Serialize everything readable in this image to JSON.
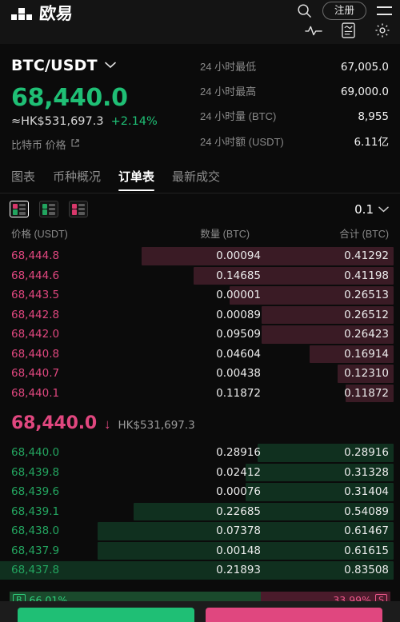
{
  "topbar": {
    "brand_name": "欧易",
    "logo_icon": "okx-logo-icon",
    "search_icon": "search-icon",
    "register_label": "注册",
    "menu_icon": "hamburger-menu-icon",
    "chart_icon": "pulse-chart-icon",
    "report_icon": "document-report-icon",
    "settings_icon": "gear-icon"
  },
  "ticker": {
    "pair": "BTC/USDT",
    "pair_chevron_icon": "chevron-down-icon",
    "last_price": "68,440.0",
    "fiat_price": "≈HK$531,697.3",
    "change_pct": "+2.14%",
    "coin_label": "比特币 价格",
    "external_link_icon": "external-link-icon",
    "up_color": "#1fbf75",
    "down_color": "#e0477f",
    "stats": [
      {
        "label": "24 小时最低",
        "value": "67,005.0"
      },
      {
        "label": "24 小时最高",
        "value": "69,000.0"
      },
      {
        "label": "24 小时量 (BTC)",
        "value": "8,955"
      },
      {
        "label": "24 小时额 (USDT)",
        "value": "6.11亿"
      }
    ]
  },
  "tabs": [
    {
      "label": "图表",
      "active": false
    },
    {
      "label": "币种概况",
      "active": false
    },
    {
      "label": "订单表",
      "active": true
    },
    {
      "label": "最新成交",
      "active": false
    }
  ],
  "controls": {
    "view_icons": [
      {
        "name": "orderbook-both-view-icon",
        "selected": true
      },
      {
        "name": "orderbook-bids-view-icon",
        "selected": false
      },
      {
        "name": "orderbook-asks-view-icon",
        "selected": false
      }
    ],
    "precision_value": "0.1",
    "precision_chevron_icon": "chevron-down-icon"
  },
  "orderbook": {
    "columns": [
      "价格 (USDT)",
      "数量 (BTC)",
      "合计 (BTC)"
    ],
    "asks": [
      {
        "price": "68,444.8",
        "amount": "0.00094",
        "total": "0.41292",
        "bar_pct": 63
      },
      {
        "price": "68,444.6",
        "amount": "0.14685",
        "total": "0.41198",
        "bar_pct": 50
      },
      {
        "price": "68,443.5",
        "amount": "0.00001",
        "total": "0.26513",
        "bar_pct": 41
      },
      {
        "price": "68,442.8",
        "amount": "0.00089",
        "total": "0.26512",
        "bar_pct": 33
      },
      {
        "price": "68,442.0",
        "amount": "0.09509",
        "total": "0.26423",
        "bar_pct": 33
      },
      {
        "price": "68,440.8",
        "amount": "0.04604",
        "total": "0.16914",
        "bar_pct": 21
      },
      {
        "price": "68,440.7",
        "amount": "0.00438",
        "total": "0.12310",
        "bar_pct": 14
      },
      {
        "price": "68,440.1",
        "amount": "0.11872",
        "total": "0.11872",
        "bar_pct": 12
      }
    ],
    "mid": {
      "price": "68,440.0",
      "direction_icon": "arrow-down-icon",
      "fiat": "HK$531,697.3"
    },
    "bids": [
      {
        "price": "68,440.0",
        "amount": "0.28916",
        "total": "0.28916",
        "bar_pct": 34
      },
      {
        "price": "68,439.8",
        "amount": "0.02412",
        "total": "0.31328",
        "bar_pct": 37
      },
      {
        "price": "68,439.6",
        "amount": "0.00076",
        "total": "0.31404",
        "bar_pct": 37
      },
      {
        "price": "68,439.1",
        "amount": "0.22685",
        "total": "0.54089",
        "bar_pct": 65
      },
      {
        "price": "68,438.0",
        "amount": "0.07378",
        "total": "0.61467",
        "bar_pct": 74
      },
      {
        "price": "68,437.9",
        "amount": "0.00148",
        "total": "0.61615",
        "bar_pct": 74
      },
      {
        "price": "68,437.8",
        "amount": "0.21893",
        "total": "0.83508",
        "bar_pct": 99
      }
    ]
  },
  "ratio": {
    "buy_tag": "B",
    "buy_pct": "66.01%",
    "sell_pct": "33.99%",
    "sell_tag": "S",
    "buy_width": 66.01
  }
}
